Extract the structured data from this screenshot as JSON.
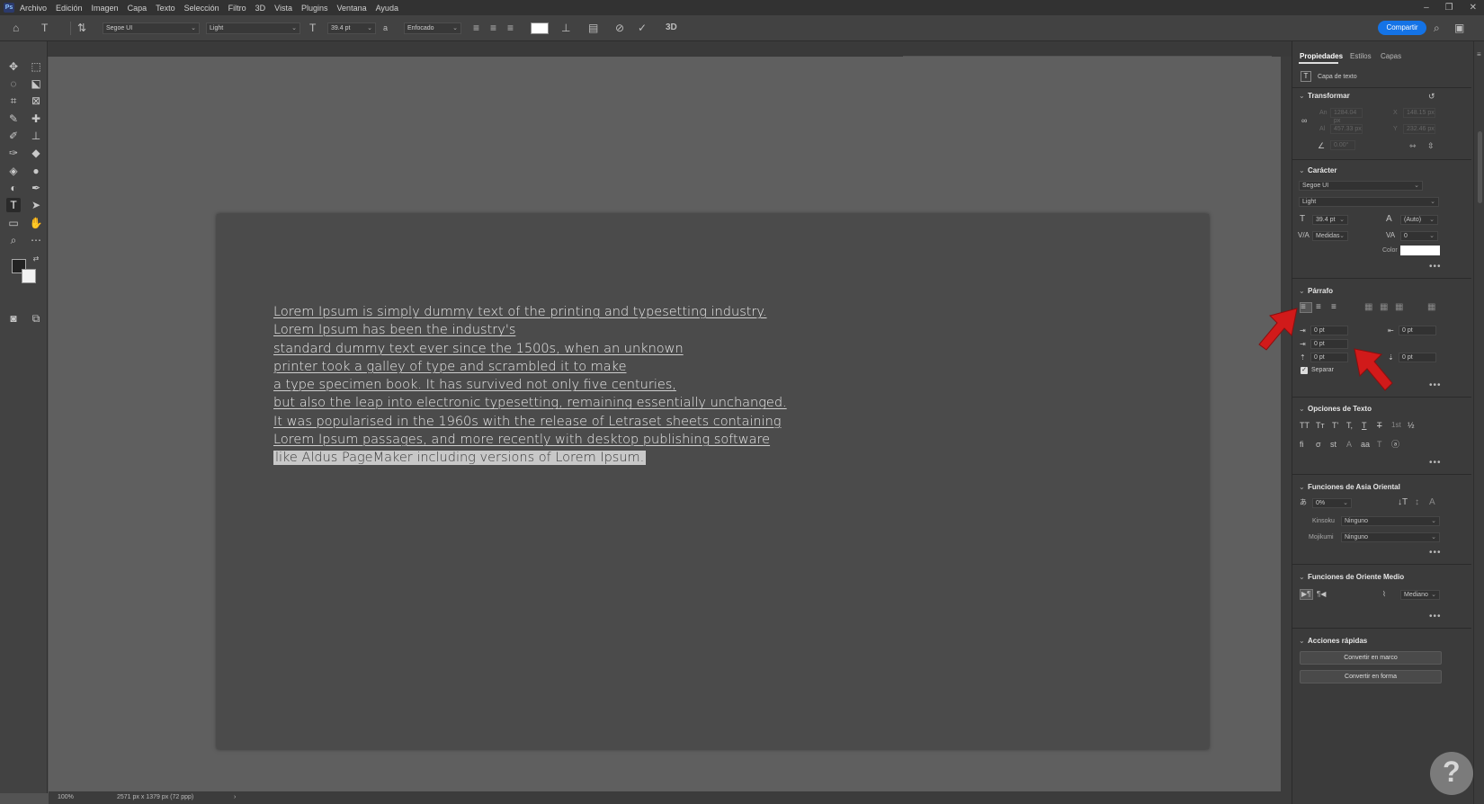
{
  "menubar": {
    "items": [
      "Archivo",
      "Edición",
      "Imagen",
      "Capa",
      "Texto",
      "Selección",
      "Filtro",
      "3D",
      "Vista",
      "Plugins",
      "Ventana",
      "Ayuda"
    ]
  },
  "options": {
    "font_family": "Segoe UI",
    "font_style": "Light",
    "font_size": "39.4 pt",
    "antialias_glyph": "a",
    "antialias": "Enfocado",
    "three_d": "3D",
    "share_label": "Compartir"
  },
  "document": {
    "lines": [
      "Lorem Ipsum is simply dummy text of the printing and typesetting industry.",
      "Lorem Ipsum has been the industry's",
      "standard dummy text ever since the 1500s, when an unknown",
      "printer took a galley of type and scrambled it to make",
      "a type specimen book. It has survived not only five centuries,",
      "but also the leap into electronic typesetting, remaining essentially unchanged.",
      "It was popularised in the 1960s with the release of Letraset sheets containing",
      "Lorem Ipsum passages, and more recently with desktop publishing software"
    ],
    "selected_line": "like Aldus PageMaker including versions of Lorem Ipsum."
  },
  "status": {
    "zoom": "100%",
    "doc_size": "2571 px x 1379 px (72 ppp)"
  },
  "panel": {
    "tabs": [
      "Propiedades",
      "Estilos",
      "Capas"
    ],
    "layer_type": "Capa de texto",
    "transform": {
      "title": "Transformar",
      "w_label": "An",
      "w": "1284.04 px",
      "x_label": "X",
      "x": "148.15 px",
      "h_label": "Al",
      "h": "457.33 px",
      "y_label": "Y",
      "y": "232.46 px",
      "angle": "0.00°"
    },
    "character": {
      "title": "Carácter",
      "font": "Segoe UI",
      "style": "Light",
      "size": "39.4 pt",
      "leading": "(Auto)",
      "kerning": "Medidas",
      "tracking": "0",
      "color_label": "Color"
    },
    "paragraph": {
      "title": "Párrafo",
      "indent_left": "0 pt",
      "indent_right": "0 pt",
      "indent_first": "0 pt",
      "space_before": "0 pt",
      "space_after": "0 pt",
      "hyphenate_label": "Separar"
    },
    "text_options": {
      "title": "Opciones de Texto"
    },
    "east_asian": {
      "title": "Funciones de Asia Oriental",
      "tsume": "0%",
      "kinsoku_label": "Kinsoku",
      "kinsoku": "Ninguno",
      "mojikumi_label": "Mojikumi",
      "mojikumi": "Ninguno"
    },
    "middle_east": {
      "title": "Funciones de Oriente Medio",
      "kashida": "Mediano"
    },
    "quick_actions": {
      "title": "Acciones rápidas",
      "btn1": "Convertir en marco",
      "btn2": "Convertir en forma"
    }
  },
  "colors": {
    "accent": "#1473e6",
    "arrow": "#d11a1a",
    "text_color_swatch": "#ffffff"
  }
}
